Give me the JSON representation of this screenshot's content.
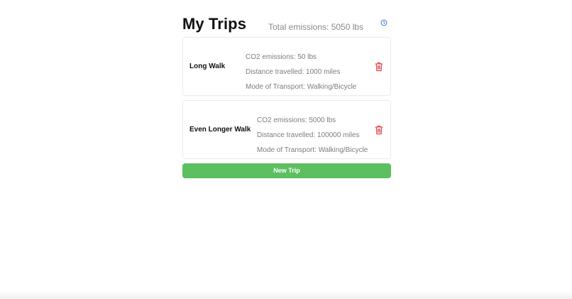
{
  "header": {
    "title": "My Trips",
    "total_emissions": "Total emissions: 5050 lbs",
    "history_icon": "clock-icon"
  },
  "trips": [
    {
      "name": "Long Walk",
      "co2": "CO2 emissions: 50 lbs",
      "distance": "Distance travelled: 1000 miles",
      "mode": "Mode of Transport: Walking/Bicycle",
      "delete_icon": "trash-icon"
    },
    {
      "name": "Even Longer Walk",
      "co2": "CO2 emissions: 5000 lbs",
      "distance": "Distance travelled: 100000 miles",
      "mode": "Mode of Transport: Walking/Bicycle",
      "delete_icon": "trash-icon"
    }
  ],
  "new_trip_button": {
    "label": "New Trip"
  },
  "colors": {
    "accent_green": "#5cbf60",
    "delete_red": "#d9363e",
    "history_blue": "#3b7be0"
  }
}
